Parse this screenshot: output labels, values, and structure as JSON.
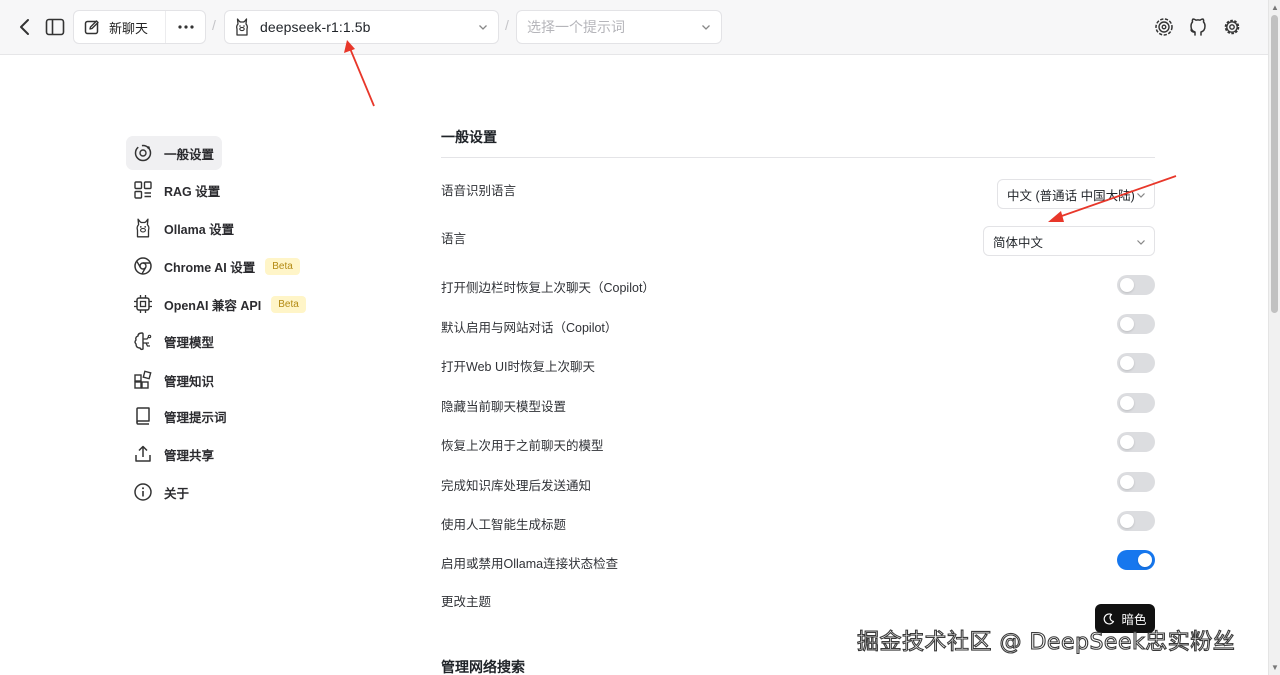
{
  "topbar": {
    "new_chat_label": "新聊天",
    "separator": "/",
    "model_name": "deepseek-r1:1.5b",
    "prompt_placeholder": "选择一个提示词"
  },
  "nav": {
    "items": [
      {
        "label": "一般设置",
        "icon": "general-settings-icon",
        "active": true
      },
      {
        "label": "RAG 设置",
        "icon": "grid-icon"
      },
      {
        "label": "Ollama 设置",
        "icon": "llama-icon"
      },
      {
        "label": "Chrome AI 设置",
        "icon": "chrome-icon",
        "badge": "Beta"
      },
      {
        "label": "OpenAI 兼容 API",
        "icon": "chip-icon",
        "badge": "Beta"
      },
      {
        "label": "管理模型",
        "icon": "brain-icon"
      },
      {
        "label": "管理知识",
        "icon": "blocks-icon"
      },
      {
        "label": "管理提示词",
        "icon": "book-icon"
      },
      {
        "label": "管理共享",
        "icon": "share-icon"
      },
      {
        "label": "关于",
        "icon": "info-icon"
      }
    ]
  },
  "main": {
    "section_title": "一般设置",
    "speech_language_label": "语音识别语言",
    "speech_language_value": "中文 (普通话 中国大陆)",
    "language_label": "语言",
    "language_value": "简体中文",
    "toggles": [
      {
        "label": "打开侧边栏时恢复上次聊天（Copilot）",
        "on": false
      },
      {
        "label": "默认启用与网站对话（Copilot）",
        "on": false
      },
      {
        "label": "打开Web UI时恢复上次聊天",
        "on": false
      },
      {
        "label": "隐藏当前聊天模型设置",
        "on": false
      },
      {
        "label": "恢复上次用于之前聊天的模型",
        "on": false
      },
      {
        "label": "完成知识库处理后发送通知",
        "on": false
      },
      {
        "label": "使用人工智能生成标题",
        "on": false
      },
      {
        "label": "启用或禁用Ollama连接状态检查",
        "on": true
      }
    ],
    "theme_label": "更改主题",
    "theme_button_label": "暗色",
    "next_section_title": "管理网络搜索"
  },
  "watermark": "掘金技术社区 @ DeepSeek忠实粉丝",
  "colors": {
    "accent": "#1677ee",
    "annotation_arrow": "#e8372a",
    "beta_bg": "#fff5c8",
    "beta_text": "#b38a13"
  }
}
